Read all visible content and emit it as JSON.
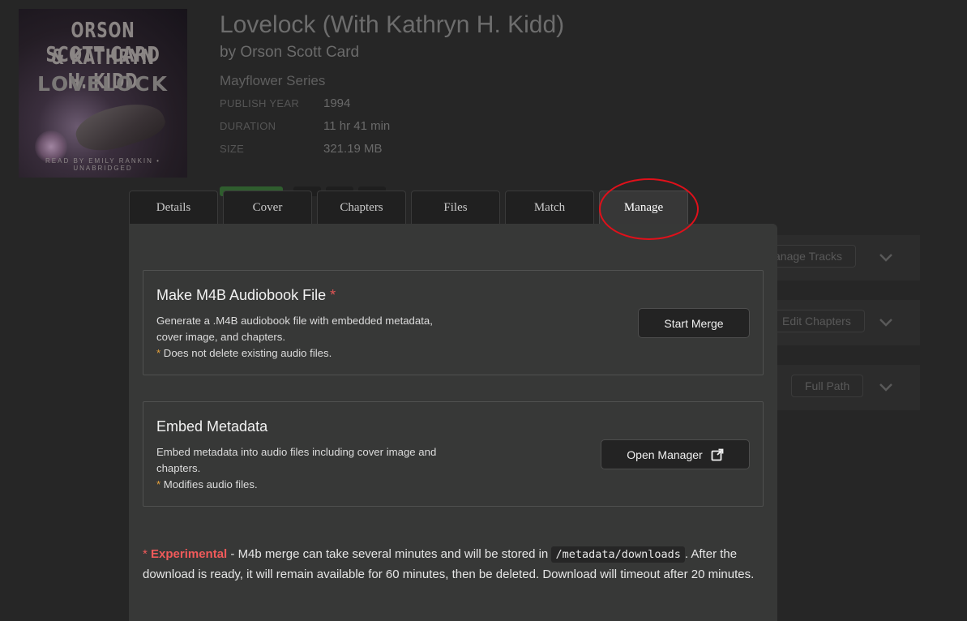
{
  "book": {
    "cover_line1": "ORSON SCOTT CARD",
    "cover_line2": "& KATHRYN H. KIDD",
    "cover_line3": "LOVELOCK",
    "cover_footer": "READ BY EMILY RANKIN • UNABRIDGED",
    "title": "Lovelock (With Kathryn H. Kidd)",
    "author": "by Orson Scott Card",
    "series": "Mayflower Series",
    "meta": [
      {
        "key": "PUBLISH YEAR",
        "value": "1994"
      },
      {
        "key": "DURATION",
        "value": "11 hr 41 min"
      },
      {
        "key": "SIZE",
        "value": "321.19 MB"
      }
    ]
  },
  "background_buttons": {
    "manage_tracks": "anage Tracks",
    "edit_chapters": "Edit Chapters",
    "full_path": "Full Path"
  },
  "tabs": [
    "Details",
    "Cover",
    "Chapters",
    "Files",
    "Match",
    "Manage"
  ],
  "active_tab": "Manage",
  "m4b": {
    "title": "Make M4B Audiobook File",
    "required_mark": "*",
    "desc_line1": "Generate a .M4B audiobook file with embedded metadata,",
    "desc_line2": "cover image, and chapters.",
    "note_star": "*",
    "note": " Does not delete existing audio files.",
    "button": "Start Merge"
  },
  "embed": {
    "title": "Embed Metadata",
    "desc_line1": "Embed metadata into audio files including cover image and",
    "desc_line2": "chapters.",
    "note_star": "*",
    "note": " Modifies audio files.",
    "button": "Open Manager"
  },
  "info": {
    "star": "* ",
    "experimental": "Experimental",
    "text1": " - M4b merge can take several minutes and will be stored in ",
    "path": "/metadata/downloads",
    "text2": ". After the download is ready, it will remain available for 60 minutes, then be deleted. Download will timeout after 20 minutes."
  },
  "colors": {
    "accent_red": "#f05a5a",
    "note_orange": "#e6a23c",
    "highlight_circle": "#e0101a",
    "modal_bg": "#373837"
  },
  "icons": {
    "open_manager_icon": "external-link-icon",
    "chevron": "chevron-down-icon"
  }
}
